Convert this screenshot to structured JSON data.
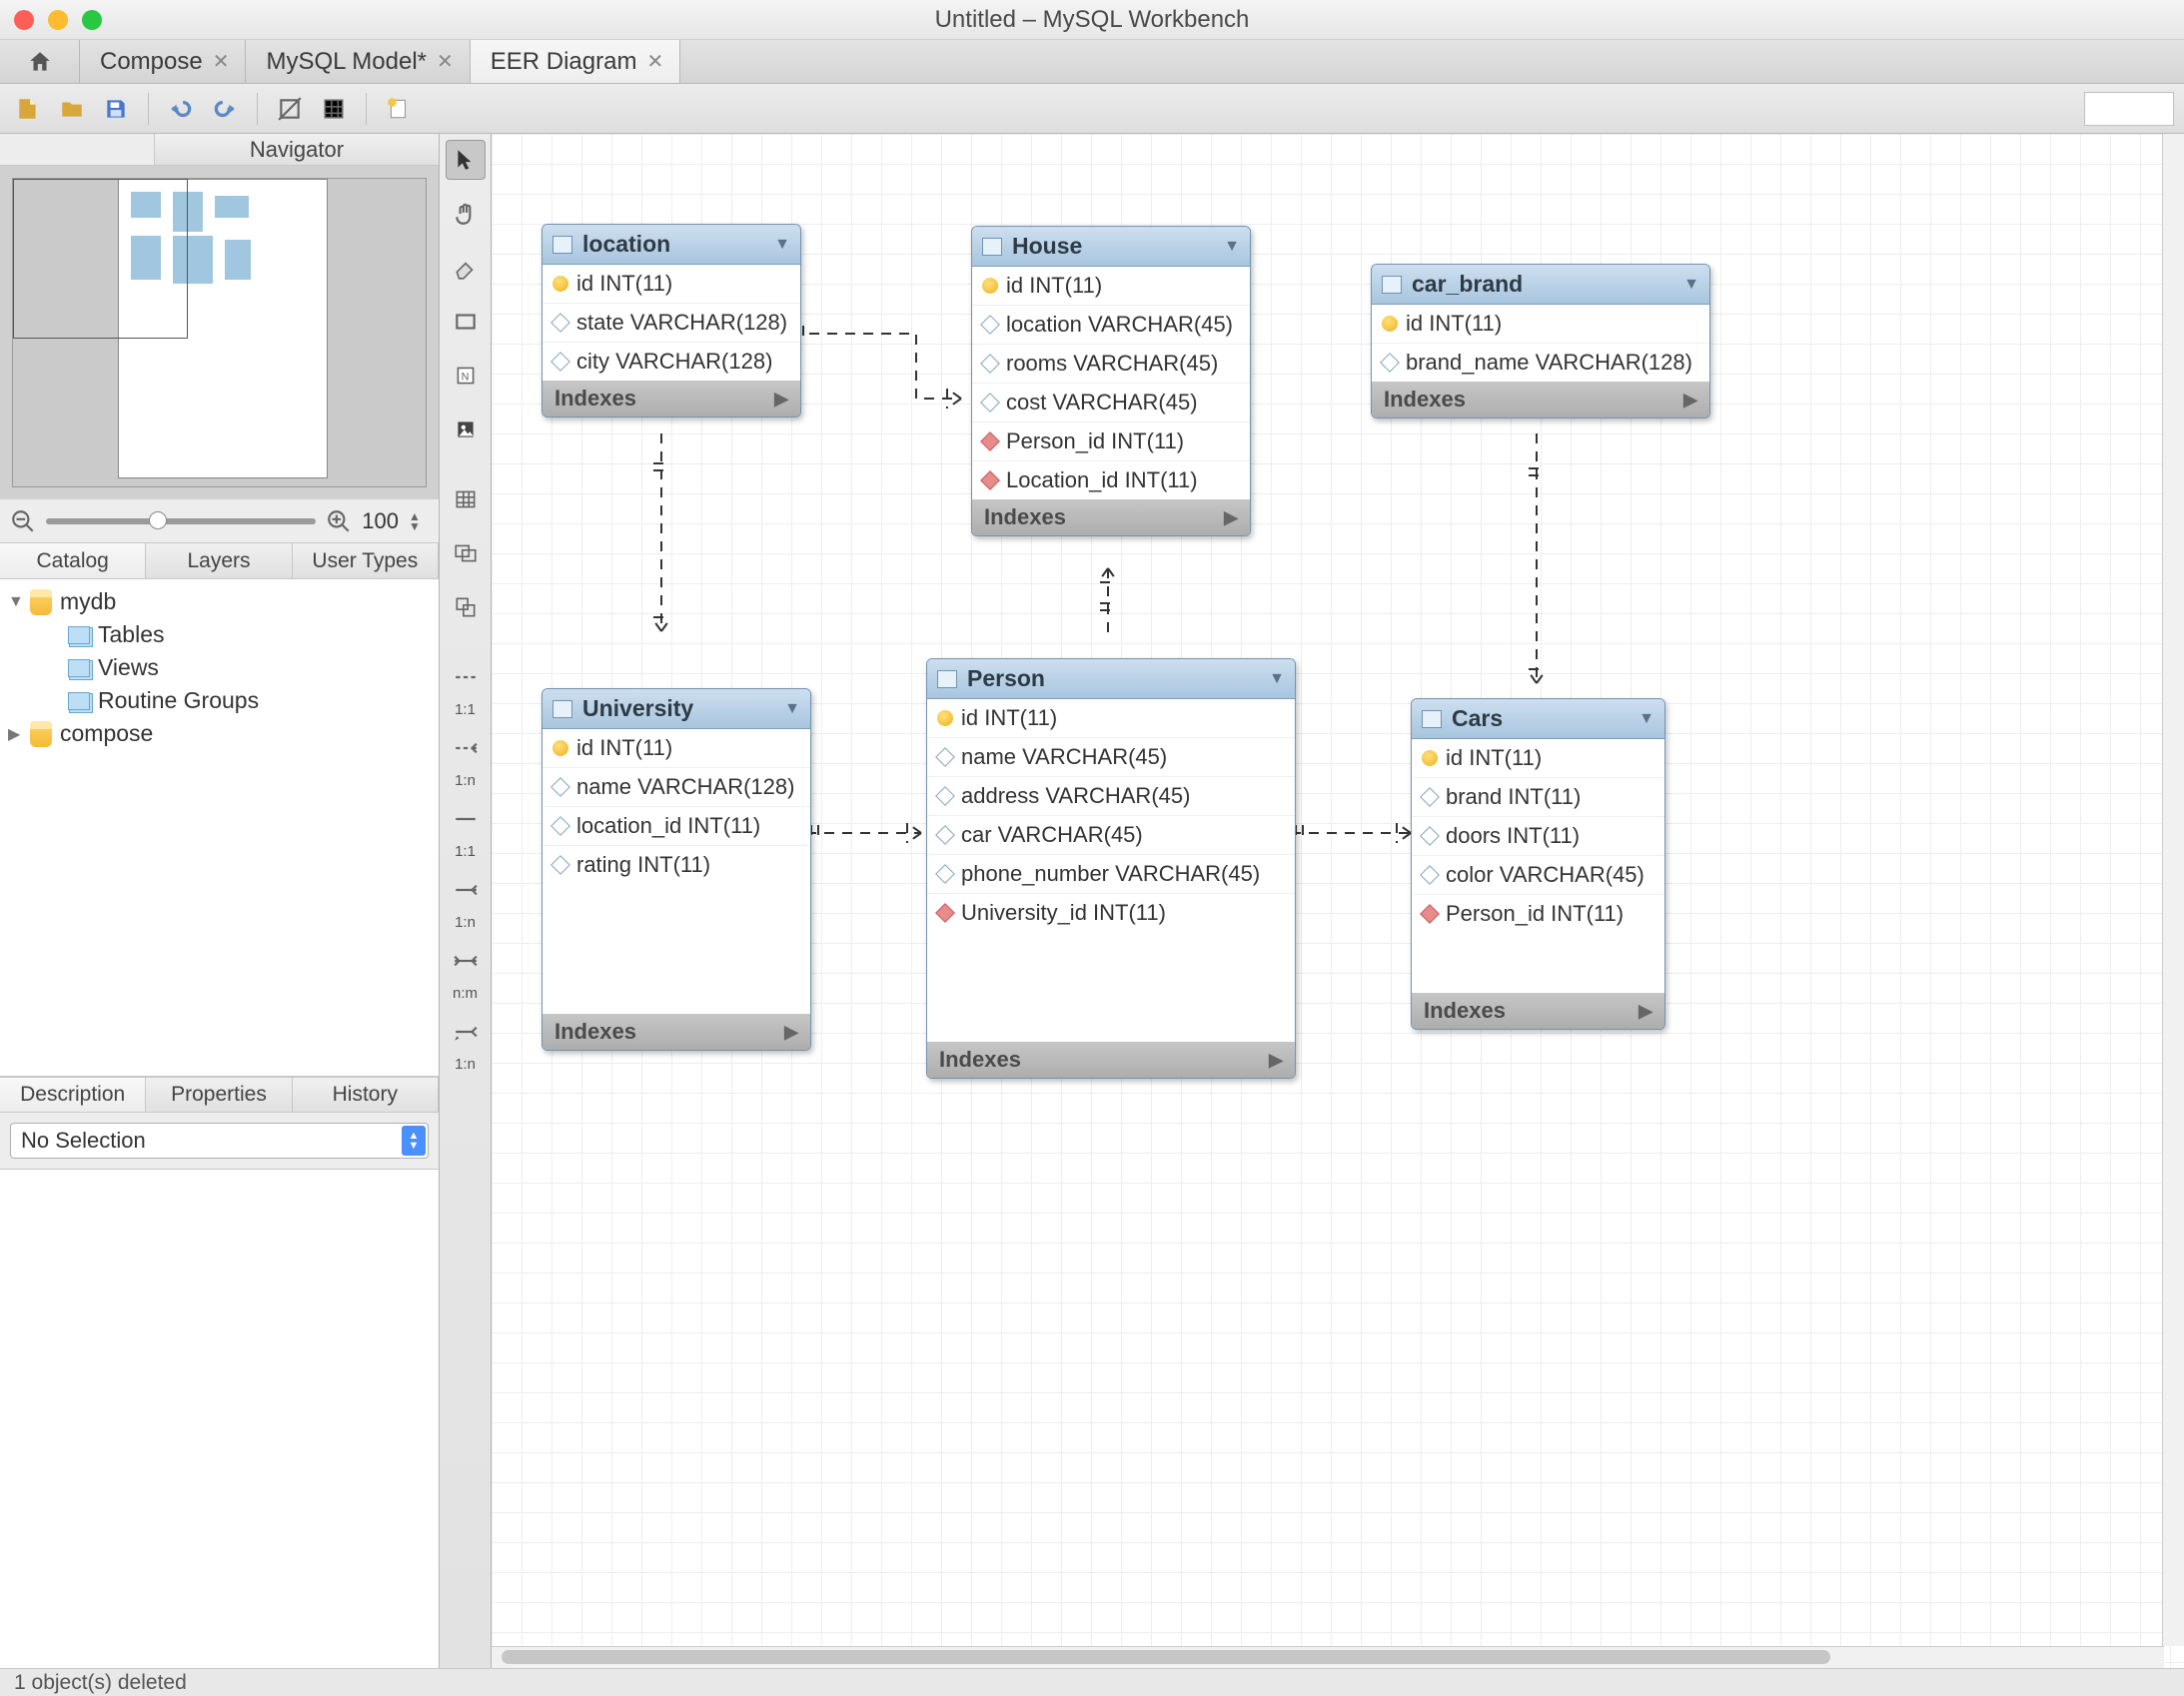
{
  "window": {
    "title": "Untitled – MySQL Workbench"
  },
  "tabs": [
    {
      "label": "Compose"
    },
    {
      "label": "MySQL Model*"
    },
    {
      "label": "EER Diagram",
      "active": true
    }
  ],
  "sidebar": {
    "navigator_label": "Navigator",
    "zoom_value": "100",
    "catalog_tabs": {
      "catalog": "Catalog",
      "layers": "Layers",
      "user_types": "User Types"
    },
    "tree": {
      "db1": "mydb",
      "db1_children": {
        "tables": "Tables",
        "views": "Views",
        "routine_groups": "Routine Groups"
      },
      "db2": "compose"
    },
    "bottom_tabs": {
      "description": "Description",
      "properties": "Properties",
      "history": "History"
    },
    "selection": "No Selection"
  },
  "palette_labels": {
    "r11i": "1:1",
    "r1ni": "1:n",
    "r11": "1:1",
    "r1n": "1:n",
    "rnm": "n:m",
    "r1np": "1:n"
  },
  "entities": {
    "location": {
      "name": "location",
      "cols": [
        {
          "k": "pk",
          "t": "id INT(11)"
        },
        {
          "k": "d",
          "t": "state VARCHAR(128)"
        },
        {
          "k": "d",
          "t": "city VARCHAR(128)"
        }
      ]
    },
    "house": {
      "name": "House",
      "cols": [
        {
          "k": "pk",
          "t": "id INT(11)"
        },
        {
          "k": "d",
          "t": "location VARCHAR(45)"
        },
        {
          "k": "d",
          "t": "rooms VARCHAR(45)"
        },
        {
          "k": "d",
          "t": "cost VARCHAR(45)"
        },
        {
          "k": "fk",
          "t": "Person_id INT(11)"
        },
        {
          "k": "fk",
          "t": "Location_id INT(11)"
        }
      ]
    },
    "car_brand": {
      "name": "car_brand",
      "cols": [
        {
          "k": "pk",
          "t": "id INT(11)"
        },
        {
          "k": "d",
          "t": "brand_name VARCHAR(128)"
        }
      ]
    },
    "university": {
      "name": "University",
      "cols": [
        {
          "k": "pk",
          "t": "id INT(11)"
        },
        {
          "k": "d",
          "t": "name VARCHAR(128)"
        },
        {
          "k": "d",
          "t": "location_id INT(11)"
        },
        {
          "k": "d",
          "t": "rating INT(11)"
        }
      ]
    },
    "person": {
      "name": "Person",
      "cols": [
        {
          "k": "pk",
          "t": "id INT(11)"
        },
        {
          "k": "d",
          "t": "name VARCHAR(45)"
        },
        {
          "k": "d",
          "t": "address VARCHAR(45)"
        },
        {
          "k": "d",
          "t": "car VARCHAR(45)"
        },
        {
          "k": "d",
          "t": "phone_number VARCHAR(45)"
        },
        {
          "k": "fk",
          "t": "University_id INT(11)"
        }
      ]
    },
    "cars": {
      "name": "Cars",
      "cols": [
        {
          "k": "pk",
          "t": "id INT(11)"
        },
        {
          "k": "d",
          "t": "brand INT(11)"
        },
        {
          "k": "d",
          "t": "doors INT(11)"
        },
        {
          "k": "d",
          "t": "color VARCHAR(45)"
        },
        {
          "k": "fk",
          "t": "Person_id INT(11)"
        }
      ]
    }
  },
  "indexes_label": "Indexes",
  "status": "1 object(s) deleted"
}
